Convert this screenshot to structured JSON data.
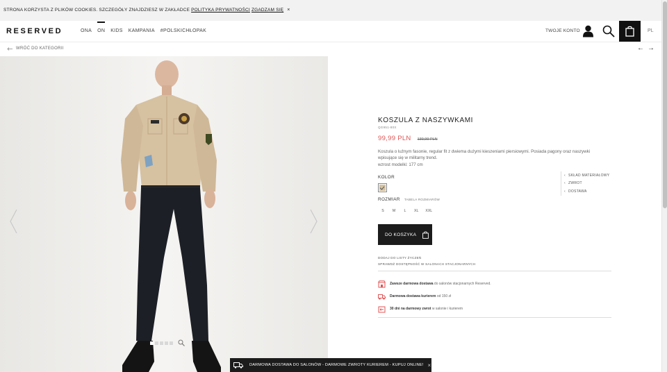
{
  "cookie": {
    "text": "STRONA KORZYSTA Z PLIKÓW COOKIES. SZCZEGÓŁY ZNAJDZIESZ W ZAKŁADCE",
    "policy_link": "POLITYKA PRYWATNOŚCI",
    "agree": "ZGADZAM SIĘ",
    "close": "×"
  },
  "header": {
    "logo": "RESERVED",
    "nav": [
      "ONA",
      "ON",
      "KIDS",
      "KAMPANIA",
      "#POLSKICHŁOPAK"
    ],
    "active_nav": "ON",
    "account": "TWOJE KONTO",
    "lang": "PL"
  },
  "breadcrumb": {
    "back": "WRÓĆ DO KATEGORII",
    "prev": "←",
    "next": "→"
  },
  "gallery": {
    "dot_count": 5,
    "active_dot": 0
  },
  "product": {
    "name": "KOSZULA Z NASZYWKAMI",
    "sku": "QG951-80X",
    "price": "99,99 PLN",
    "old_price": "139,99 PLN",
    "description": "Koszula o luźnym fasonie, regular fit z dwiema dużymi kieszeniami piersiowymi. Posiada pagony oraz naszywki wpisujące się w militarny trend.",
    "model_height": "wzrost modelki: 177 cm",
    "color_label": "KOLOR",
    "color_swatch": "#d5c3a4",
    "size_label": "ROZMIAR",
    "size_table": "TABELA ROZMIARÓW",
    "sizes": [
      "S",
      "M",
      "L",
      "XL",
      "XXL"
    ],
    "add_to_cart": "DO KOSZYKA",
    "wishlist": "DODAJ DO LISTY ŻYCZEŃ",
    "store_check": "SPRAWDŹ DOSTĘPNOŚĆ W SALONACH STACJONARNYCH"
  },
  "perks": [
    {
      "bold": "Zawsze darmowa dostawa",
      "rest": "do salonów stacjonarnych Reserved.",
      "icon": "store-icon"
    },
    {
      "bold": "Darmowa dostawa kurierem",
      "rest": "od 150 zł",
      "icon": "truck-icon"
    },
    {
      "bold": "30 dni na darmowy zwrot",
      "rest": "w salonie i kurierem",
      "icon": "return-icon"
    }
  ],
  "side_links": [
    "SKŁAD MATERIAŁOWY",
    "ZWROT",
    "DOSTAWA"
  ],
  "banner": {
    "text": "DARMOWA DOSTAWA DO SALONÓW - DARMOWE ZWROTY KURIEREM - KUPUJ ONLINE!",
    "close": "×"
  },
  "colors": {
    "accent_price": "#e05656",
    "cart_bg": "#111111",
    "perk_icon": "#e05656"
  }
}
